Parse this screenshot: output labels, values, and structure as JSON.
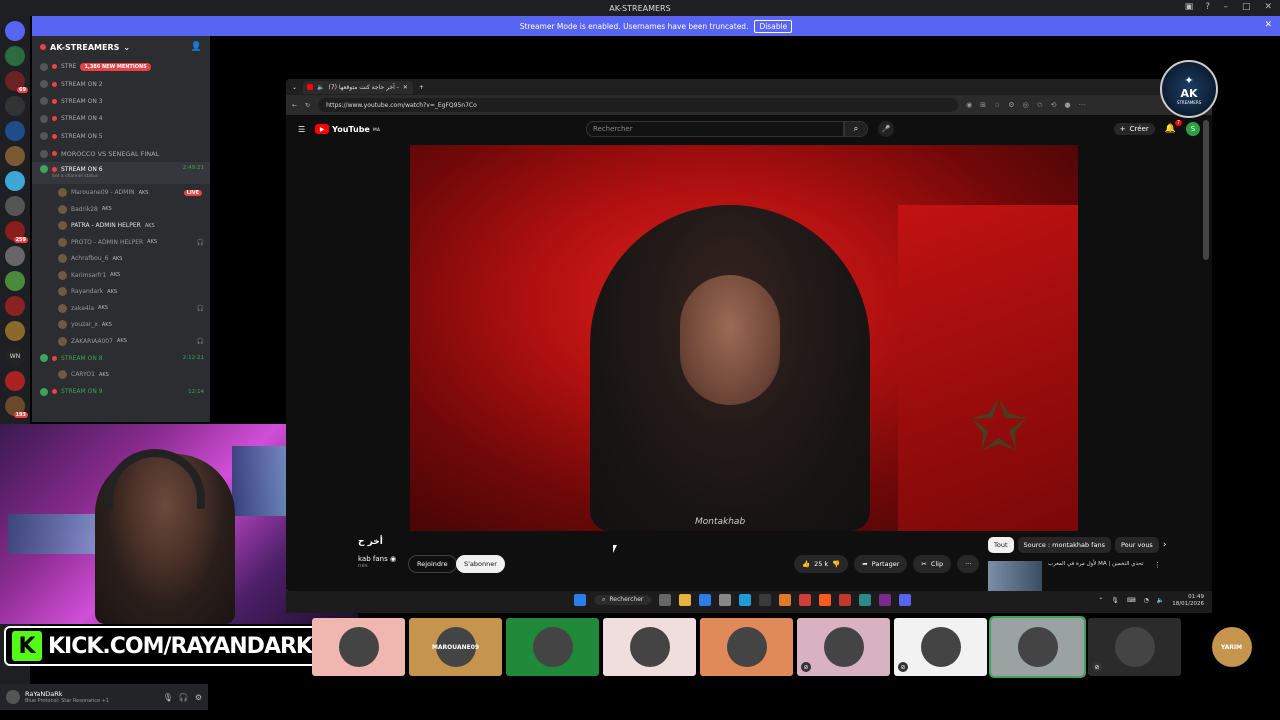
{
  "discord": {
    "window_title": "AK-STREAMERS",
    "banner": {
      "text": "Streamer Mode is enabled. Usernames have been truncated.",
      "button": "Disable"
    },
    "server": {
      "name": "AK-STREAMERS"
    },
    "guild_badges": [
      "",
      "69",
      "",
      "",
      "",
      "",
      "",
      "259",
      "7",
      "21",
      "",
      "",
      "",
      "WN",
      "",
      "193"
    ],
    "channels": [
      {
        "name": "STRE",
        "mentions": "1,386 NEW MENTIONS"
      },
      {
        "name": "STREAM ON 2"
      },
      {
        "name": "STREAM ON 3"
      },
      {
        "name": "STREAM ON 4"
      },
      {
        "name": "STREAM ON 5"
      },
      {
        "name": "MOROCCO VS SENEGAL FINAL"
      }
    ],
    "active_channel": {
      "name": "STREAM ON 6",
      "time": "2:49:21",
      "status": "Set a channel status"
    },
    "voice_users": [
      {
        "name": "Marouane09 - ADMIN",
        "tag": "AKS",
        "badge": "LIVE"
      },
      {
        "name": "Badrik28",
        "tag": "AKS"
      },
      {
        "name": "PATRA - ADMIN HELPER",
        "tag": "AKS"
      },
      {
        "name": "PROTO - ADMIN HELPER",
        "tag": "AKS"
      },
      {
        "name": "Achrafbou_6",
        "tag": "AKS"
      },
      {
        "name": "Karimsarfr1",
        "tag": "AKS"
      },
      {
        "name": "Rayandark",
        "tag": "AKS"
      },
      {
        "name": "zaka4la",
        "tag": "AKS"
      },
      {
        "name": "youzar_x",
        "tag": "AKS"
      },
      {
        "name": "ZAKARIAA007",
        "tag": "AKS"
      }
    ],
    "channel8": {
      "name": "STREAM ON 8",
      "time": "2:12:21"
    },
    "channel8_user": {
      "name": "CARYO1",
      "tag": "AKS"
    },
    "channel9": {
      "name": "STREAM ON 9",
      "time": "12:14"
    },
    "user_panel": {
      "name": "RaYaNDaRk",
      "status": "Blue Protocol: Star Resonance +1"
    }
  },
  "overlay": {
    "kick_text": "KICK.COM/RAYANDARK",
    "kick_letter": "K",
    "ak_logo": "AK",
    "ak_sub": "STREAMERS"
  },
  "browser": {
    "tab_title": "(7) آخر حاجة كنت متوقعها -",
    "url": "https://www.youtube.com/watch?v=_EgFQ95n7Co"
  },
  "youtube": {
    "logo": "YouTube",
    "region": "MA",
    "search_placeholder": "Rechercher",
    "create_label": "Créer",
    "notif_count": "7",
    "avatar_letter": "S",
    "video_title": "أخر ح",
    "channel": "kab fans",
    "channel_subs": "nés",
    "join": "Rejoindre",
    "subscribe": "S'abonner",
    "likes": "25 k",
    "share": "Partager",
    "clip": "Clip",
    "chips": [
      "Tout",
      "Source : montakhab fans",
      "Pour vous"
    ],
    "rec_title": "لأول مرة في المغرب MA | تحدي التخمين",
    "video_overlay": "Montakhab"
  },
  "taskbar": {
    "search": "Rechercher",
    "time": "01:49",
    "date": "18/01/2026"
  },
  "tiles": [
    {
      "label": "",
      "color": "#f0b6b0"
    },
    {
      "label": "MAROUANE09",
      "color": "#c5954e"
    },
    {
      "label": "",
      "color": "#1f8a3a"
    },
    {
      "label": "",
      "color": "#f0dede"
    },
    {
      "label": "",
      "color": "#e08a5a"
    },
    {
      "label": "",
      "color": "#d8b2c0"
    },
    {
      "label": "",
      "color": "#f2f2f2"
    },
    {
      "label": "",
      "color": "#9aa3a2"
    },
    {
      "label": "",
      "color": "#2b2b2b"
    },
    {
      "label": "YARIM",
      "color": "#000000"
    }
  ]
}
